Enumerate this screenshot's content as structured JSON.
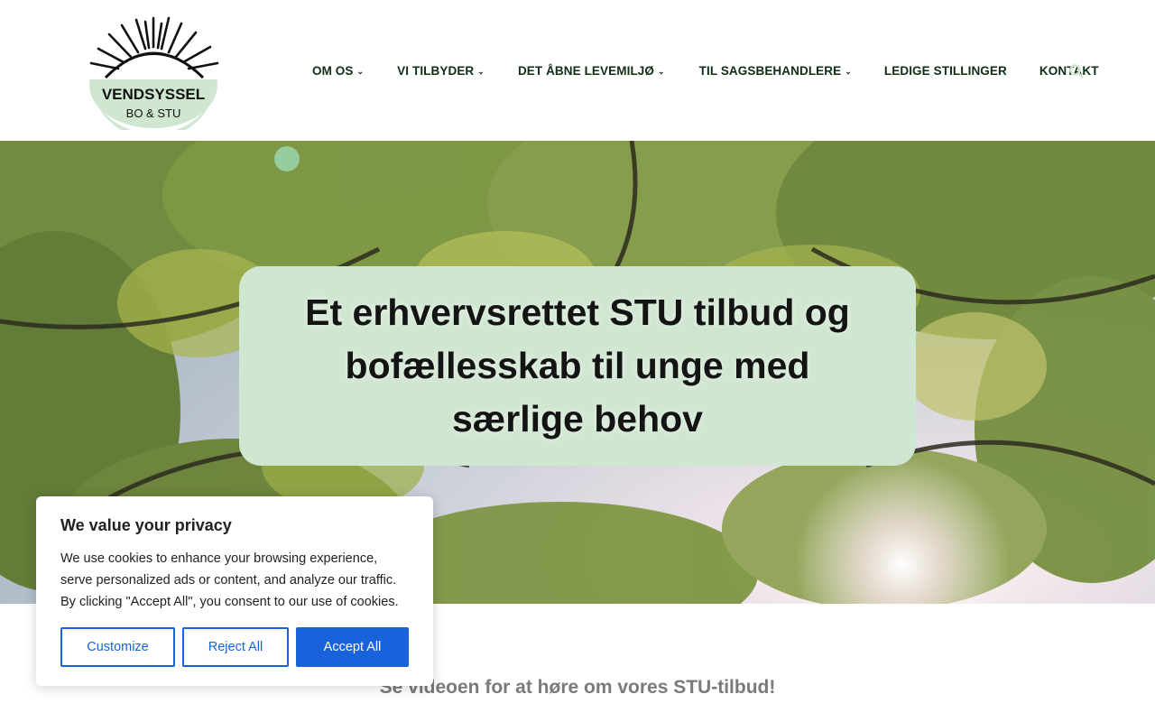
{
  "logo": {
    "line1": "VENDSYSSEL",
    "line2": "BO & STU",
    "colors": {
      "circle": "#cfe6d0",
      "ink": "#111111"
    }
  },
  "nav": {
    "items": [
      {
        "label": "OM OS",
        "has_dropdown": true
      },
      {
        "label": "VI TILBYDER",
        "has_dropdown": true
      },
      {
        "label": "DET ÅBNE LEVEMILJØ",
        "has_dropdown": true
      },
      {
        "label": "TIL SAGSBEHANDLERE",
        "has_dropdown": true
      },
      {
        "label": "LEDIGE STILLINGER",
        "has_dropdown": false
      },
      {
        "label": "KONTAKT",
        "has_dropdown": false
      }
    ],
    "dropdown_glyph": "⌄",
    "search_icon": "search-icon"
  },
  "hero": {
    "title": "Et erhvervsrettet STU tilbud og bofællesskab til unge med særlige behov",
    "box_color": "#cfe6d0"
  },
  "section": {
    "subtitle": "Se videoen for at høre om vores STU-tilbud!"
  },
  "cookie": {
    "title": "We value your privacy",
    "text": "We use cookies to enhance your browsing experience, serve personalized ads or content, and analyze our traffic. By clicking \"Accept All\", you consent to our use of cookies.",
    "customize_label": "Customize",
    "reject_label": "Reject All",
    "accept_label": "Accept All",
    "accent_color": "#1863dc"
  }
}
